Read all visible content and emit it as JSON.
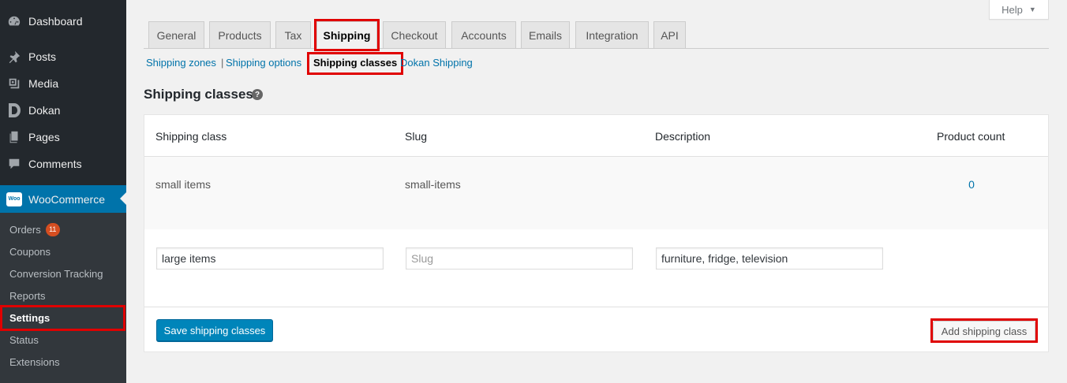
{
  "sidebar": {
    "items": [
      {
        "label": "Dashboard",
        "icon": "dashboard-icon"
      },
      {
        "label": "Posts",
        "icon": "pin-icon"
      },
      {
        "label": "Media",
        "icon": "media-icon"
      },
      {
        "label": "Dokan",
        "icon": "dokan-icon"
      },
      {
        "label": "Pages",
        "icon": "pages-icon"
      },
      {
        "label": "Comments",
        "icon": "comments-icon"
      }
    ],
    "woocommerce": {
      "label": "WooCommerce",
      "icon_text": "Woo"
    },
    "submenu": [
      {
        "label": "Orders",
        "badge": "11"
      },
      {
        "label": "Coupons"
      },
      {
        "label": "Conversion Tracking"
      },
      {
        "label": "Reports"
      },
      {
        "label": "Settings"
      },
      {
        "label": "Status"
      },
      {
        "label": "Extensions"
      }
    ]
  },
  "help": {
    "label": "Help"
  },
  "tabs": [
    "General",
    "Products",
    "Tax",
    "Shipping",
    "Checkout",
    "Accounts",
    "Emails",
    "Integration",
    "API"
  ],
  "active_tab": "Shipping",
  "sections": [
    "Shipping zones",
    "Shipping options",
    "Shipping classes",
    "Dokan Shipping"
  ],
  "section_separator": "|",
  "page_title": "Shipping classes",
  "help_tip": "?",
  "table": {
    "headers": [
      "Shipping class",
      "Slug",
      "Description",
      "Product count"
    ],
    "existing_row": {
      "name": "small items",
      "slug": "small-items",
      "description": "",
      "count": "0"
    },
    "new_row": {
      "name_value": "large items",
      "slug_value": "",
      "slug_placeholder": "Slug",
      "description_value": "furniture, fridge, television"
    },
    "save_label": "Save shipping classes",
    "add_label": "Add shipping class"
  },
  "colors": {
    "accent": "#0073aa",
    "button_primary": "#0085ba",
    "highlight": "#e00000",
    "sidebar_bg": "#23282d"
  }
}
